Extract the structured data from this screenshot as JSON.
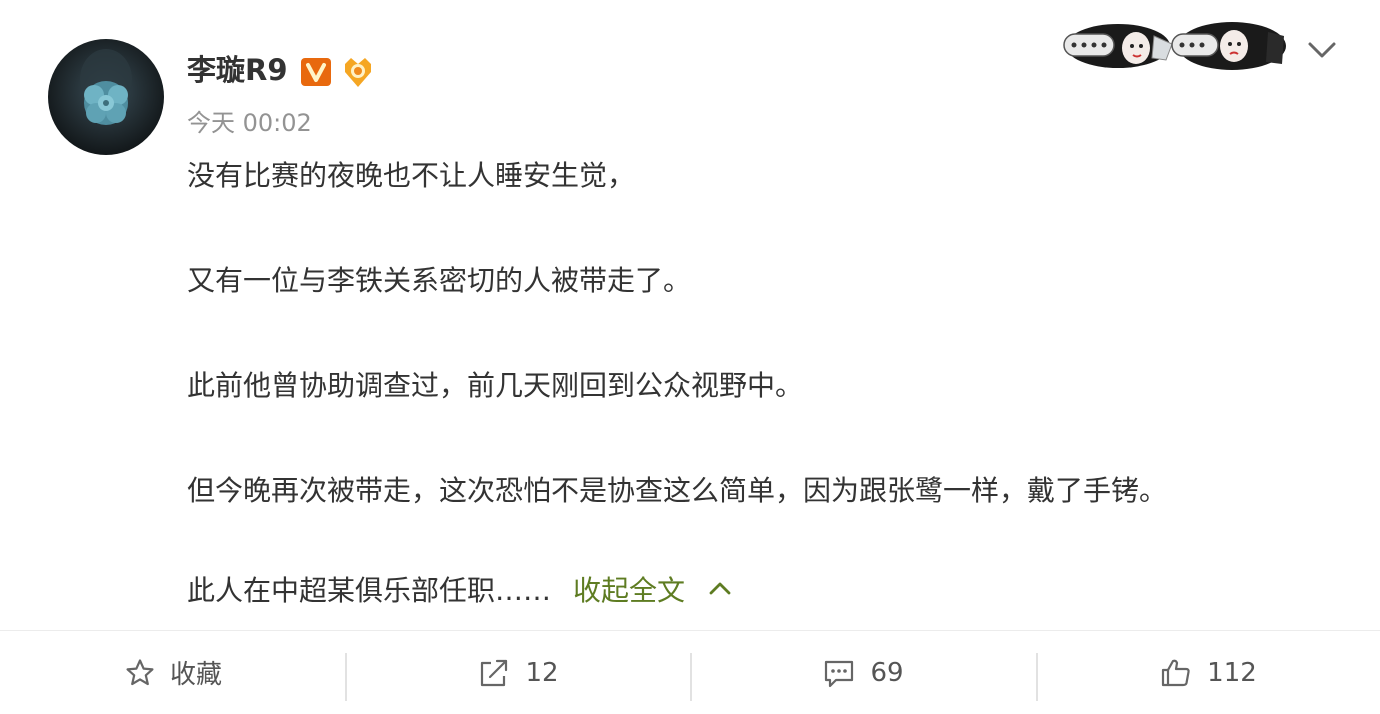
{
  "post": {
    "username": "李璇R9",
    "time": "今天 00:02",
    "paragraphs": [
      "没有比赛的夜晚也不让人睡安生觉，",
      "又有一位与李铁关系密切的人被带走了。",
      "此前他曾协助调查过，前几天刚回到公众视野中。",
      "但今晚再次被带走，这次恐怕不是协查这么简单，因为跟张鹭一样，戴了手铐。",
      "此人在中超某俱乐部任职……"
    ],
    "collapse_label": "收起全文"
  },
  "header": {
    "verified_badge_icon": "verified-v-icon",
    "medal_icon": "fan-medal-icon",
    "menu_icon": "chevron-down-icon"
  },
  "footer": {
    "favorite_label": "收藏",
    "repost_count": "12",
    "comment_count": "69",
    "like_count": "112"
  },
  "colors": {
    "text": "#333333",
    "muted": "#939393",
    "link": "#5e7c22",
    "verified": "#e8690e",
    "medal": "#f5a623"
  }
}
